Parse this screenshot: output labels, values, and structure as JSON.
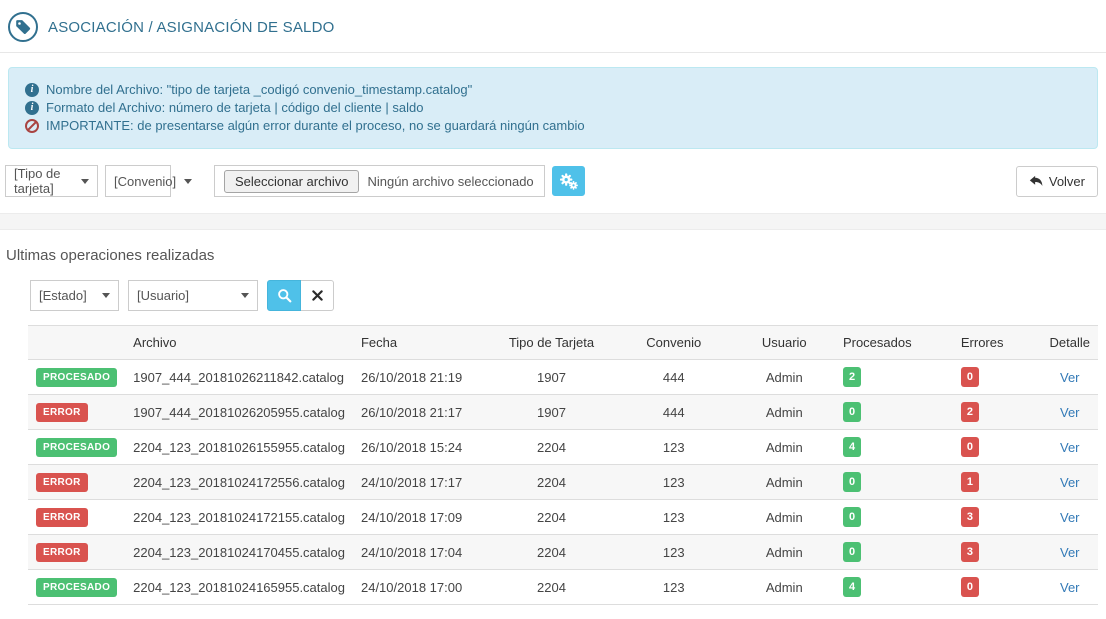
{
  "header": {
    "title": "ASOCIACIÓN / ASIGNACIÓN DE SALDO"
  },
  "info_box": {
    "lines": [
      "Nombre del Archivo: \"tipo de tarjeta _codigó convenio_timestamp.catalog\"",
      "Formato del Archivo: número de tarjeta | código del cliente | saldo",
      "IMPORTANTE: de presentarse algún error durante el proceso, no se guardará ningún cambio"
    ]
  },
  "upload_form": {
    "card_type_select": "[Tipo de tarjeta]",
    "agreement_select": "[Convenio]",
    "file_button": "Seleccionar archivo",
    "file_status": "Ningún archivo seleccionado",
    "back_button": "Volver"
  },
  "operations": {
    "title": "Ultimas operaciones realizadas",
    "filters": {
      "estado_select": "[Estado]",
      "usuario_select": "[Usuario]"
    },
    "table": {
      "headers": [
        "",
        "Archivo",
        "Fecha",
        "Tipo de Tarjeta",
        "Convenio",
        "Usuario",
        "Procesados",
        "Errores",
        "Detalle"
      ],
      "rows": [
        {
          "status": "PROCESADO",
          "archivo": "1907_444_20181026211842.catalog",
          "fecha": "26/10/2018 21:19",
          "tipo": "1907",
          "convenio": "444",
          "usuario": "Admin",
          "procesados": "2",
          "errores": "0",
          "detalle": "Ver"
        },
        {
          "status": "ERROR",
          "archivo": "1907_444_20181026205955.catalog",
          "fecha": "26/10/2018 21:17",
          "tipo": "1907",
          "convenio": "444",
          "usuario": "Admin",
          "procesados": "0",
          "errores": "2",
          "detalle": "Ver"
        },
        {
          "status": "PROCESADO",
          "archivo": "2204_123_20181026155955.catalog",
          "fecha": "26/10/2018 15:24",
          "tipo": "2204",
          "convenio": "123",
          "usuario": "Admin",
          "procesados": "4",
          "errores": "0",
          "detalle": "Ver"
        },
        {
          "status": "ERROR",
          "archivo": "2204_123_20181024172556.catalog",
          "fecha": "24/10/2018 17:17",
          "tipo": "2204",
          "convenio": "123",
          "usuario": "Admin",
          "procesados": "0",
          "errores": "1",
          "detalle": "Ver"
        },
        {
          "status": "ERROR",
          "archivo": "2204_123_20181024172155.catalog",
          "fecha": "24/10/2018 17:09",
          "tipo": "2204",
          "convenio": "123",
          "usuario": "Admin",
          "procesados": "0",
          "errores": "3",
          "detalle": "Ver"
        },
        {
          "status": "ERROR",
          "archivo": "2204_123_20181024170455.catalog",
          "fecha": "24/10/2018 17:04",
          "tipo": "2204",
          "convenio": "123",
          "usuario": "Admin",
          "procesados": "0",
          "errores": "3",
          "detalle": "Ver"
        },
        {
          "status": "PROCESADO",
          "archivo": "2204_123_20181024165955.catalog",
          "fecha": "24/10/2018 17:00",
          "tipo": "2204",
          "convenio": "123",
          "usuario": "Admin",
          "procesados": "4",
          "errores": "0",
          "detalle": "Ver"
        }
      ]
    }
  },
  "colors": {
    "heading_blue": "#31708f",
    "info_bg": "#d9edf7",
    "info_border": "#bce8f1",
    "accent_blue": "#4fc1e9",
    "success_green": "#4cc073",
    "danger_red": "#d9534f",
    "link_blue": "#337ab7",
    "ban_red": "#a94442"
  }
}
